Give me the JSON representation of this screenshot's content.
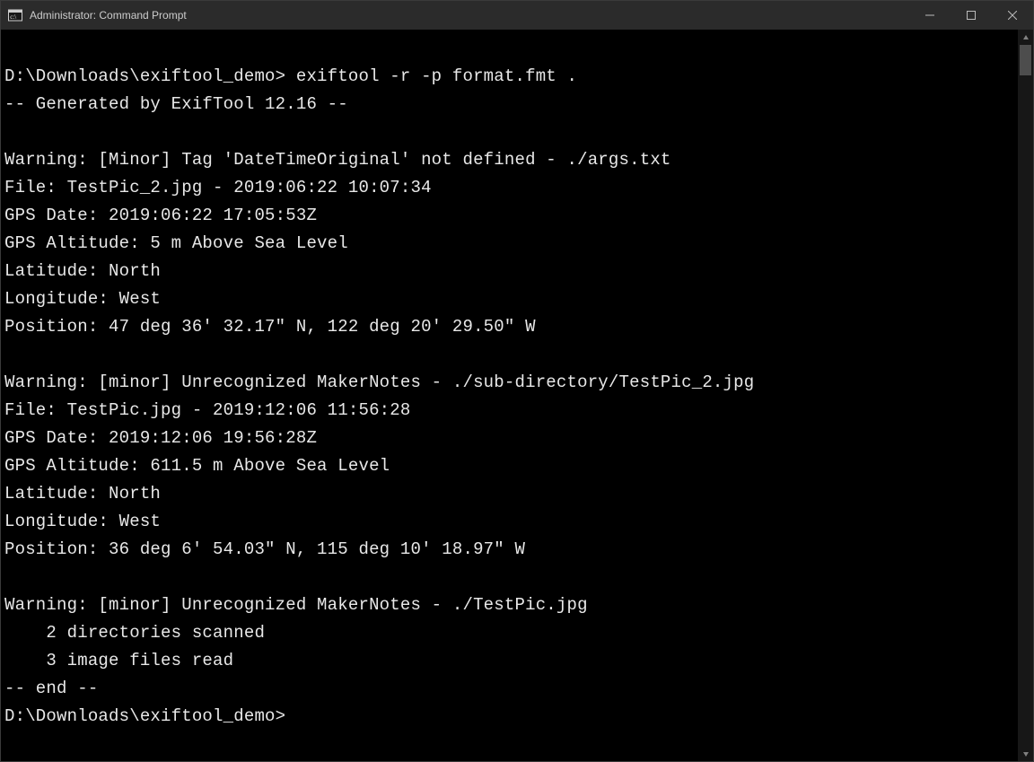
{
  "window": {
    "title": "Administrator: Command Prompt"
  },
  "terminal": {
    "prompt1": "D:\\Downloads\\exiftool_demo>",
    "command1": " exiftool -r -p format.fmt .",
    "lines": [
      "-- Generated by ExifTool 12.16 --",
      "",
      "Warning: [Minor] Tag 'DateTimeOriginal' not defined - ./args.txt",
      "File: TestPic_2.jpg - 2019:06:22 10:07:34",
      "GPS Date: 2019:06:22 17:05:53Z",
      "GPS Altitude: 5 m Above Sea Level",
      "Latitude: North",
      "Longitude: West",
      "Position: 47 deg 36' 32.17\" N, 122 deg 20' 29.50\" W",
      "",
      "Warning: [minor] Unrecognized MakerNotes - ./sub-directory/TestPic_2.jpg",
      "File: TestPic.jpg - 2019:12:06 11:56:28",
      "GPS Date: 2019:12:06 19:56:28Z",
      "GPS Altitude: 611.5 m Above Sea Level",
      "Latitude: North",
      "Longitude: West",
      "Position: 36 deg 6' 54.03\" N, 115 deg 10' 18.97\" W",
      "",
      "Warning: [minor] Unrecognized MakerNotes - ./TestPic.jpg",
      "    2 directories scanned",
      "    3 image files read",
      "-- end --"
    ],
    "prompt2": "D:\\Downloads\\exiftool_demo>"
  }
}
